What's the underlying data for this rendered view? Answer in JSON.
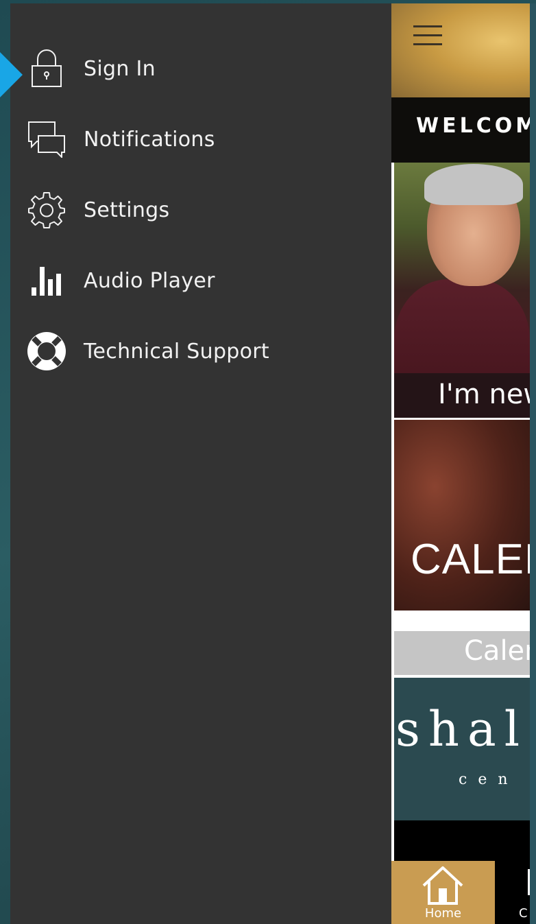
{
  "drawer": {
    "items": [
      {
        "label": "Sign In",
        "icon": "lock-icon",
        "selected": true
      },
      {
        "label": "Notifications",
        "icon": "chat-bubbles-icon"
      },
      {
        "label": "Settings",
        "icon": "gear-icon"
      },
      {
        "label": "Audio Player",
        "icon": "equalizer-bars-icon"
      },
      {
        "label": "Technical Support",
        "icon": "lifebuoy-icon"
      }
    ],
    "selected_indicator_color": "#19a6e6",
    "background_color": "#333333"
  },
  "app": {
    "header_icon": "hamburger-menu-icon",
    "welcome": "WELCOM",
    "tiles": {
      "new_caption": "I'm new",
      "calendar_image_text": "CALEN",
      "calendar_label": "Calen",
      "shalom_text": "shal",
      "shalom_sub": "cen"
    },
    "tabbar": {
      "home_label": "Home",
      "home_icon": "home-icon",
      "next_label": "C"
    },
    "accent_color": "#c99c52"
  }
}
